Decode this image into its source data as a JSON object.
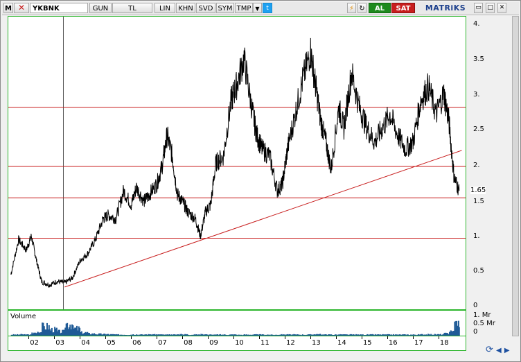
{
  "toolbar": {
    "logo": "M",
    "symbol": "YKBNK",
    "buttons": [
      "GUN",
      "TL",
      "LIN",
      "KHN",
      "SVD",
      "SYM",
      "TMP"
    ],
    "dropdown_icon": "triangle-down",
    "twitter_icon": "twitter-bird",
    "al_label": "AL",
    "sat_label": "SAT",
    "brand": "MATRiKS",
    "window_buttons": [
      "minimize",
      "restore",
      "close"
    ]
  },
  "price_axis": {
    "ticks": [
      "4.",
      "3.5",
      "3.",
      "2.5",
      "2.",
      "1.5",
      "1.",
      "0.5",
      "0"
    ],
    "current": "1.65"
  },
  "volume": {
    "label": "Volume",
    "ticks": [
      "1. Mr",
      "0.5 Mr",
      "0"
    ]
  },
  "x_axis": {
    "labels": [
      "02",
      "03",
      "04",
      "05",
      "06",
      "07",
      "08",
      "09",
      "10",
      "11",
      "12",
      "13",
      "14",
      "15",
      "16",
      "17",
      "18"
    ]
  },
  "colors": {
    "price_line": "#000000",
    "support_lines": "#c81e1e",
    "trend_line": "#c81e1e",
    "volume_bars": "#1f5a96",
    "frame": "#2bb52b"
  },
  "chart_data": {
    "type": "line",
    "title": "",
    "xlabel": "",
    "ylabel": "",
    "ylim": [
      0,
      4
    ],
    "horizontal_levels": [
      2.8,
      1.95,
      1.5,
      0.92
    ],
    "trend_line": {
      "from": {
        "x": 2003.3,
        "y": 0.22
      },
      "to": {
        "x": 2018.8,
        "y": 2.18
      }
    },
    "x": [
      2001.2,
      2001.5,
      2001.8,
      2002.0,
      2002.2,
      2002.4,
      2002.7,
      2003.0,
      2003.3,
      2003.6,
      2003.9,
      2004.2,
      2004.5,
      2004.8,
      2005.0,
      2005.3,
      2005.6,
      2005.9,
      2006.1,
      2006.4,
      2006.6,
      2006.9,
      2007.1,
      2007.3,
      2007.5,
      2007.7,
      2007.9,
      2008.1,
      2008.4,
      2008.6,
      2008.8,
      2009.0,
      2009.2,
      2009.5,
      2009.8,
      2010.0,
      2010.3,
      2010.6,
      2010.8,
      2011.0,
      2011.3,
      2011.6,
      2011.8,
      2012.0,
      2012.3,
      2012.6,
      2012.9,
      2013.1,
      2013.3,
      2013.5,
      2013.7,
      2014.0,
      2014.2,
      2014.5,
      2014.8,
      2015.1,
      2015.4,
      2015.7,
      2016.0,
      2016.3,
      2016.6,
      2016.9,
      2017.2,
      2017.5,
      2017.8,
      2018.1,
      2018.3,
      2018.5,
      2018.7
    ],
    "series": [
      {
        "values": [
          0.4,
          0.9,
          0.75,
          0.95,
          0.6,
          0.3,
          0.25,
          0.3,
          0.28,
          0.35,
          0.6,
          0.7,
          0.9,
          1.2,
          1.25,
          1.2,
          1.6,
          1.4,
          1.65,
          1.45,
          1.55,
          1.7,
          1.95,
          2.4,
          2.1,
          1.55,
          1.45,
          1.3,
          1.2,
          0.95,
          1.3,
          1.4,
          2.0,
          2.1,
          2.9,
          3.1,
          3.5,
          2.8,
          2.4,
          2.2,
          2.1,
          1.6,
          1.7,
          2.2,
          2.7,
          3.2,
          3.6,
          3.1,
          2.6,
          2.3,
          1.9,
          2.8,
          2.5,
          3.3,
          2.8,
          2.5,
          2.3,
          2.5,
          2.7,
          2.4,
          2.2,
          2.3,
          2.9,
          3.1,
          2.7,
          3.0,
          2.6,
          1.8,
          1.6
        ]
      }
    ],
    "volume": [
      0.05,
      0.06,
      0.05,
      0.12,
      0.18,
      0.45,
      0.3,
      0.2,
      0.6,
      0.35,
      0.15,
      0.1,
      0.08,
      0.07,
      0.06,
      0.05,
      0.05,
      0.06,
      0.05,
      0.05,
      0.06,
      0.05,
      0.04,
      0.05,
      0.05,
      0.06,
      0.06,
      0.05,
      0.05,
      0.06,
      0.05,
      0.04,
      0.05,
      0.05,
      0.05,
      0.04,
      0.05,
      0.05,
      0.05,
      0.05,
      0.04,
      0.05,
      0.05,
      0.05,
      0.05,
      0.05,
      0.06,
      0.06,
      0.05,
      0.05,
      0.05,
      0.05,
      0.05,
      0.05,
      0.05,
      0.05,
      0.05,
      0.05,
      0.05,
      0.05,
      0.05,
      0.05,
      0.06,
      0.06,
      0.06,
      0.1,
      0.2,
      0.6,
      0.3
    ]
  }
}
